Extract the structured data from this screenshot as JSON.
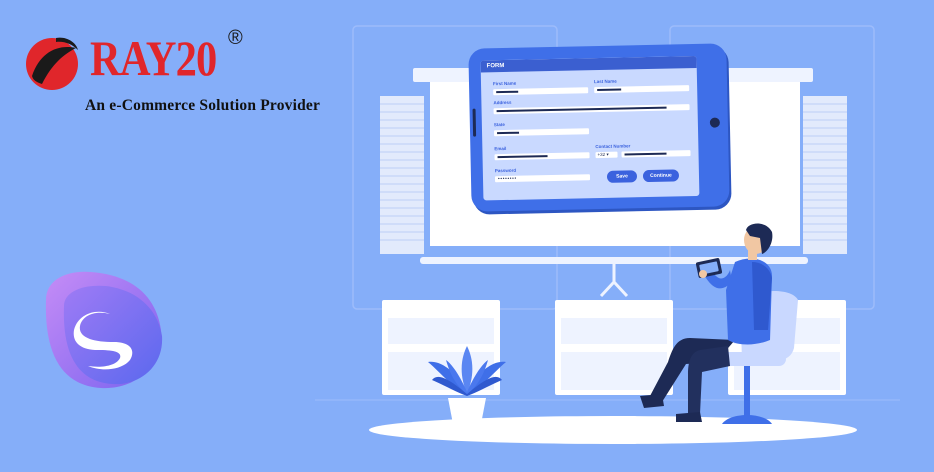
{
  "brand": {
    "name": "RAY20",
    "registered_mark": "®",
    "tagline": "An e-Commerce Solution Provider"
  },
  "app_icon": {
    "name": "shopware-logo-icon"
  },
  "tablet_form": {
    "header": "FORM",
    "first_name_label": "First Name",
    "last_name_label": "Last Name",
    "address_label": "Address",
    "state_label": "State",
    "email_label": "Email",
    "contact_label": "Contact Number",
    "country_code": "+32",
    "password_label": "Password",
    "password_value": "••••••••",
    "save_label": "Save",
    "continue_label": "Continue"
  },
  "colors": {
    "background": "#85aef9",
    "brand_red": "#e0262b",
    "tablet_blue": "#3f6fe8",
    "dark_navy": "#1d2a55"
  }
}
